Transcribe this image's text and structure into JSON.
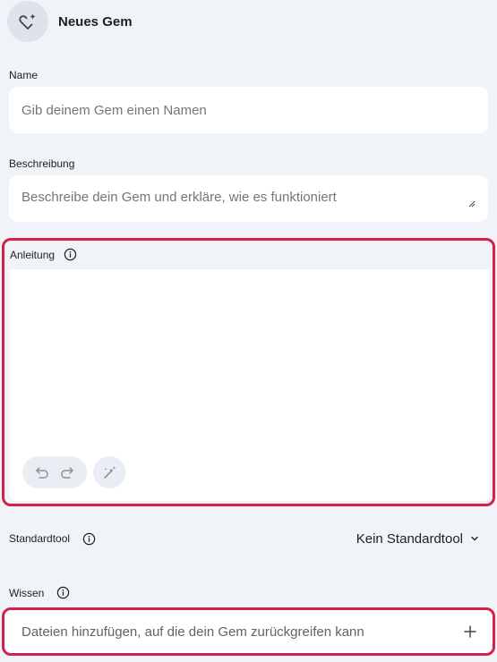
{
  "header": {
    "title": "Neues Gem",
    "icon": "gem-heart-sparkle-icon"
  },
  "name": {
    "label": "Name",
    "placeholder": "Gib deinem Gem einen Namen",
    "value": ""
  },
  "description": {
    "label": "Beschreibung",
    "placeholder": "Beschreibe dein Gem und erkläre, wie es funktioniert",
    "value": ""
  },
  "instructions": {
    "label": "Anleitung",
    "value": ""
  },
  "default_tool": {
    "label": "Standardtool",
    "selected": "Kein Standardtool"
  },
  "knowledge": {
    "label": "Wissen",
    "add_text": "Dateien hinzufügen, auf die dein Gem zurückgreifen kann"
  },
  "colors": {
    "highlight": "#d1224b",
    "background": "#f0f4f9",
    "field": "#ffffff"
  }
}
